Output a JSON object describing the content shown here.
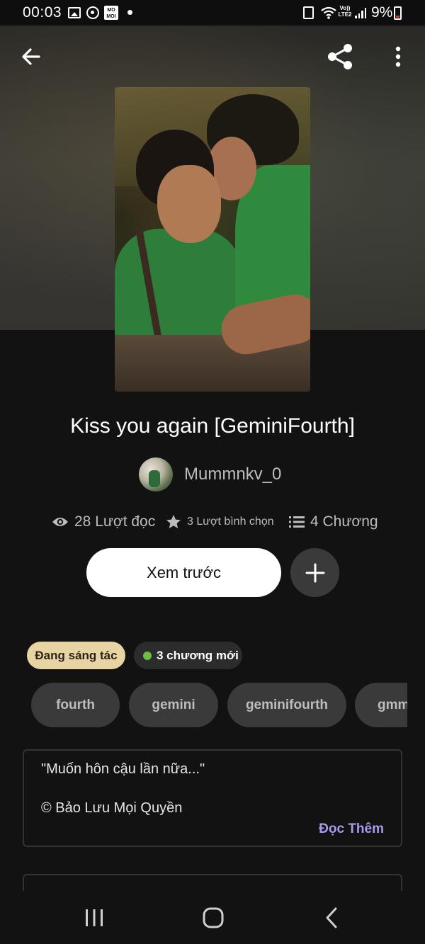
{
  "status_bar": {
    "time": "00:03",
    "momo_label_line1": "MO",
    "momo_label_line2": "MOI",
    "lte_label_line1": "Vo))",
    "lte_label_line2": "LTE2",
    "battery": "9%"
  },
  "story": {
    "title": "Kiss you again [GeminiFourth]",
    "author": "Mummnkv_0",
    "stats": {
      "reads": "28 Lượt đọc",
      "votes": "3 Lượt bình chọn",
      "parts": "4 Chương"
    },
    "preview_button": "Xem trước",
    "status_badge": "Đang sáng tác",
    "new_parts_badge": "3 chương mới",
    "tags": [
      "fourth",
      "gemini",
      "geminifourth",
      "gmm"
    ],
    "description": {
      "quote": "\"Muốn hôn cậu lần nữa...\"",
      "copyright": "© Bảo Lưu Mọi Quyền",
      "read_more": "Đọc Thêm"
    }
  },
  "icons": {
    "back": "arrow-left-icon",
    "share": "share-icon",
    "more": "more-vertical-icon",
    "add": "plus-icon",
    "reads": "eye-icon",
    "votes": "star-icon",
    "parts": "list-icon",
    "recents": "recents-icon",
    "home": "home-icon",
    "nav_back": "chevron-left-icon"
  },
  "colors": {
    "background": "#121212",
    "status_badge": "#e8d3a2",
    "new_dot": "#6abf45",
    "read_more": "#a99ae8",
    "battery_low": "#e53935"
  }
}
